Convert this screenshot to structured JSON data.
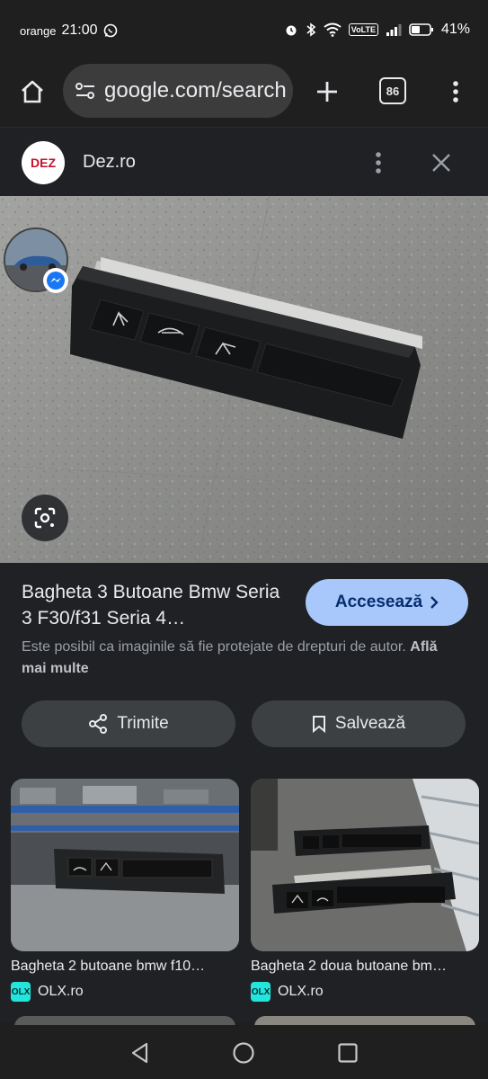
{
  "status_bar": {
    "carrier": "orange",
    "time": "21:00",
    "volte": "VoLTE",
    "battery": "41%"
  },
  "browser": {
    "url": "google.com/search",
    "tab_count": "86"
  },
  "site": {
    "logo_text": "DEZ",
    "name": "Dez.ro"
  },
  "result": {
    "title": "Bagheta 3 Butoane Bmw Seria 3 F30/f31 Seria 4…",
    "visit_label": "Accesează",
    "copyright_text": "Este posibil ca imaginile să fie protejate de drepturi de autor.",
    "learn_more": "Află mai multe",
    "share_label": "Trimite",
    "save_label": "Salvează"
  },
  "related": [
    {
      "title": "Bagheta 2 butoane bmw f10…",
      "source": "OLX.ro",
      "source_icon": "OLX"
    },
    {
      "title": "Bagheta 2 doua butoane bm…",
      "source": "OLX.ro",
      "source_icon": "OLX"
    }
  ],
  "colors": {
    "accent": "#a8c7fa",
    "background": "#202124",
    "button": "#3c4043"
  }
}
